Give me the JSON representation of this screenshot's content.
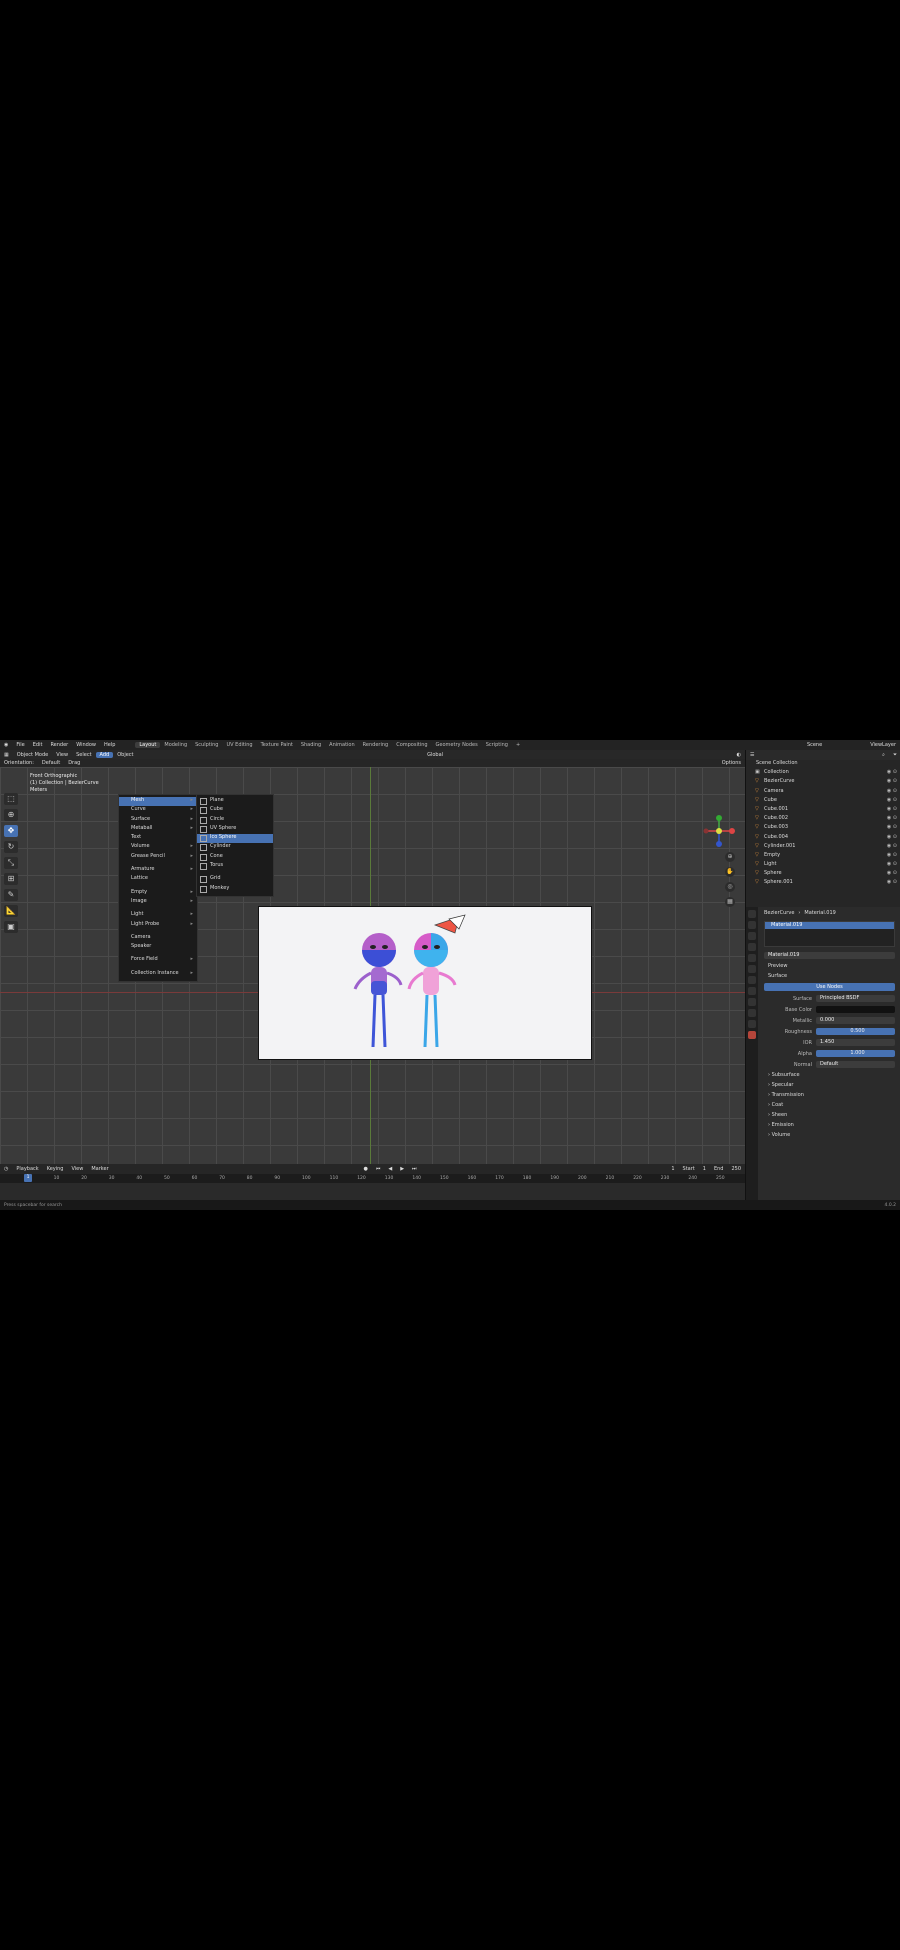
{
  "menu": [
    "File",
    "Edit",
    "Render",
    "Window",
    "Help"
  ],
  "workspaces": [
    {
      "label": "Layout",
      "active": true
    },
    {
      "label": "Modeling"
    },
    {
      "label": "Sculpting"
    },
    {
      "label": "UV Editing"
    },
    {
      "label": "Texture Paint"
    },
    {
      "label": "Shading"
    },
    {
      "label": "Animation"
    },
    {
      "label": "Rendering"
    },
    {
      "label": "Compositing"
    },
    {
      "label": "Geometry Nodes"
    },
    {
      "label": "Scripting"
    },
    {
      "label": "+"
    }
  ],
  "scene": {
    "label": "Scene",
    "view_layer": "ViewLayer"
  },
  "header": {
    "mode": "Object Mode",
    "view": "View",
    "select": "Select",
    "add": "Add",
    "object": "Object",
    "orientation_label": "Orientation:",
    "orientation_value": "Default",
    "drag": "Drag",
    "transform": "Global",
    "options": "Options"
  },
  "viewport": {
    "view_name": "Front Orthographic",
    "collection": "(1) Collection | BezierCurve",
    "units": "Meters"
  },
  "add_menu": [
    {
      "label": "Mesh",
      "active": true
    },
    {
      "label": "Curve"
    },
    {
      "label": "Surface"
    },
    {
      "label": "Metaball"
    },
    {
      "label": "Text",
      "nosub": true
    },
    {
      "label": "Volume"
    },
    {
      "label": "Grease Pencil"
    },
    {
      "sep": true
    },
    {
      "label": "Armature"
    },
    {
      "label": "Lattice",
      "nosub": true
    },
    {
      "sep": true
    },
    {
      "label": "Empty"
    },
    {
      "label": "Image"
    },
    {
      "sep": true
    },
    {
      "label": "Light"
    },
    {
      "label": "Light Probe"
    },
    {
      "sep": true
    },
    {
      "label": "Camera",
      "nosub": true
    },
    {
      "label": "Speaker",
      "nosub": true
    },
    {
      "sep": true
    },
    {
      "label": "Force Field"
    },
    {
      "sep": true
    },
    {
      "label": "Collection Instance"
    }
  ],
  "mesh_menu": [
    {
      "label": "Plane"
    },
    {
      "label": "Cube"
    },
    {
      "label": "Circle"
    },
    {
      "label": "UV Sphere"
    },
    {
      "label": "Ico Sphere",
      "active": true
    },
    {
      "label": "Cylinder"
    },
    {
      "label": "Cone"
    },
    {
      "label": "Torus"
    },
    {
      "sep": true
    },
    {
      "label": "Grid"
    },
    {
      "label": "Monkey"
    }
  ],
  "timeline": {
    "playback": "Playback",
    "keying": "Keying",
    "view": "View",
    "marker": "Marker",
    "current_frame": "1",
    "start_label": "Start",
    "start": "1",
    "end_label": "End",
    "end": "250",
    "ticks": [
      "0",
      "10",
      "20",
      "30",
      "40",
      "50",
      "60",
      "70",
      "80",
      "90",
      "100",
      "110",
      "120",
      "130",
      "140",
      "150",
      "160",
      "170",
      "180",
      "190",
      "200",
      "210",
      "220",
      "230",
      "240",
      "250"
    ]
  },
  "status": {
    "hint": "Press spacebar for search",
    "version": "4.0.2"
  },
  "outliner": {
    "root": "Scene Collection",
    "rows": [
      {
        "label": "Collection",
        "coll": true
      },
      {
        "label": "BezierCurve"
      },
      {
        "label": "Camera"
      },
      {
        "label": "Cube"
      },
      {
        "label": "Cube.001"
      },
      {
        "label": "Cube.002"
      },
      {
        "label": "Cube.003"
      },
      {
        "label": "Cube.004"
      },
      {
        "label": "Cylinder.001"
      },
      {
        "label": "Empty"
      },
      {
        "label": "Light"
      },
      {
        "label": "Sphere"
      },
      {
        "label": "Sphere.001"
      }
    ]
  },
  "properties": {
    "object": "BezierCurve",
    "material": "Material.019",
    "slot": "Material.019",
    "preview": "Preview",
    "surface_section": "Surface",
    "use_nodes": "Use Nodes",
    "fields": [
      {
        "label": "Surface",
        "value": "Principled BSDF"
      },
      {
        "label": "Base Color",
        "value": ""
      },
      {
        "label": "Metallic",
        "value": "0.000"
      },
      {
        "label": "Roughness",
        "value": "0.500",
        "blue": true
      },
      {
        "label": "IOR",
        "value": "1.450"
      },
      {
        "label": "Alpha",
        "value": "1.000",
        "blue": true
      },
      {
        "label": "Normal",
        "value": "Default"
      }
    ],
    "sections": [
      "Subsurface",
      "Specular",
      "Transmission",
      "Coat",
      "Sheen",
      "Emission",
      "Volume"
    ]
  },
  "colors": {
    "accent": "#4772b3",
    "bg": "#1d1d1d",
    "header": "#232323"
  }
}
